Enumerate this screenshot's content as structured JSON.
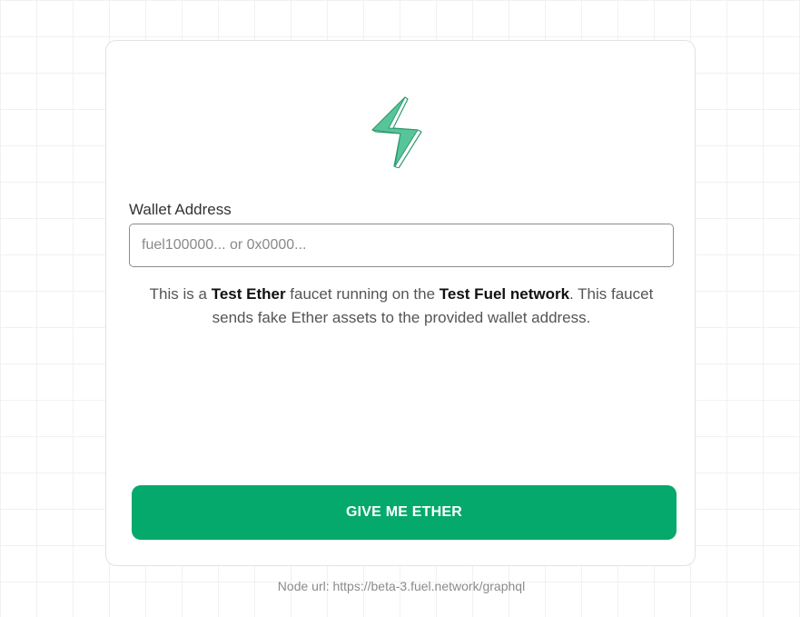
{
  "app": {
    "logo_icon": "fuel-lightning-bolt-icon",
    "logo_color": "#58c49a",
    "accent_color": "#04a96b"
  },
  "form": {
    "wallet_label": "Wallet Address",
    "wallet_placeholder": "fuel100000... or 0x0000...",
    "wallet_value": "",
    "description": {
      "part1": "This is a ",
      "bold1": "Test Ether",
      "part2": " faucet running on the ",
      "bold2": "Test Fuel network",
      "part3": ". This faucet sends fake Ether assets to the provided wallet address."
    },
    "submit_label": "GIVE ME ETHER"
  },
  "footer": {
    "node_url_text": "Node url: https://beta-3.fuel.network/graphql"
  }
}
